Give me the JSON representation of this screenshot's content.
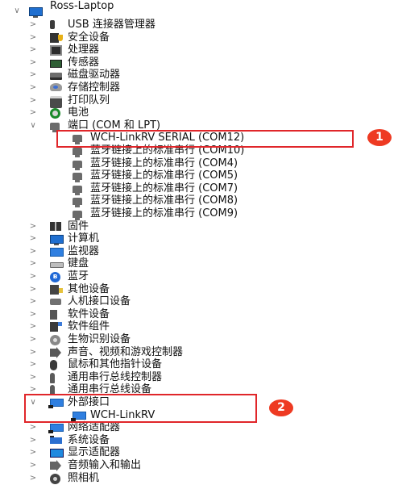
{
  "root": {
    "label": "Ross-Laptop",
    "icon": "computer-icon"
  },
  "categories": [
    {
      "label": "USB 连接器管理器",
      "icon": "usb-connector-icon"
    },
    {
      "label": "安全设备",
      "icon": "security-device-icon"
    },
    {
      "label": "处理器",
      "icon": "processor-icon"
    },
    {
      "label": "传感器",
      "icon": "sensor-icon"
    },
    {
      "label": "磁盘驱动器",
      "icon": "disk-drive-icon"
    },
    {
      "label": "存储控制器",
      "icon": "storage-controller-icon"
    },
    {
      "label": "打印队列",
      "icon": "printer-icon"
    },
    {
      "label": "电池",
      "icon": "battery-icon"
    },
    {
      "label": "端口 (COM 和 LPT)",
      "icon": "port-icon",
      "expanded": true
    },
    {
      "label": "固件",
      "icon": "firmware-icon"
    },
    {
      "label": "计算机",
      "icon": "computer-icon"
    },
    {
      "label": "监视器",
      "icon": "monitor-icon"
    },
    {
      "label": "键盘",
      "icon": "keyboard-icon"
    },
    {
      "label": "蓝牙",
      "icon": "bluetooth-icon"
    },
    {
      "label": "其他设备",
      "icon": "other-device-icon"
    },
    {
      "label": "人机接口设备",
      "icon": "hid-icon"
    },
    {
      "label": "软件设备",
      "icon": "software-device-icon"
    },
    {
      "label": "软件组件",
      "icon": "software-component-icon"
    },
    {
      "label": "生物识别设备",
      "icon": "biometric-icon"
    },
    {
      "label": "声音、视频和游戏控制器",
      "icon": "audio-icon"
    },
    {
      "label": "鼠标和其他指针设备",
      "icon": "mouse-icon"
    },
    {
      "label": "通用串行总线控制器",
      "icon": "usb-controller-icon"
    },
    {
      "label": "通用串行总线设备",
      "icon": "usb-device-icon"
    },
    {
      "label": "外部接口",
      "icon": "external-interface-icon",
      "expanded": true
    },
    {
      "label": "网络适配器",
      "icon": "network-adapter-icon"
    },
    {
      "label": "系统设备",
      "icon": "system-device-icon"
    },
    {
      "label": "显示适配器",
      "icon": "display-adapter-icon"
    },
    {
      "label": "音频输入和输出",
      "icon": "audio-io-icon"
    },
    {
      "label": "照相机",
      "icon": "camera-icon"
    }
  ],
  "ports_children": [
    "WCH-LinkRV SERIAL (COM12)",
    "蓝牙链接上的标准串行 (COM10)",
    "蓝牙链接上的标准串行 (COM4)",
    "蓝牙链接上的标准串行 (COM5)",
    "蓝牙链接上的标准串行 (COM7)",
    "蓝牙链接上的标准串行 (COM8)",
    "蓝牙链接上的标准串行 (COM9)"
  ],
  "external_children": [
    "WCH-LinkRV"
  ],
  "chevrons": {
    "collapsed": ">",
    "expanded": "∨"
  },
  "annotations": [
    {
      "badge": "1",
      "target": "WCH-LinkRV SERIAL (COM12)"
    },
    {
      "badge": "2",
      "target": "外部接口 / WCH-LinkRV"
    }
  ],
  "colors": {
    "annotation": "#e0262a",
    "badge": "#ee3a22"
  }
}
